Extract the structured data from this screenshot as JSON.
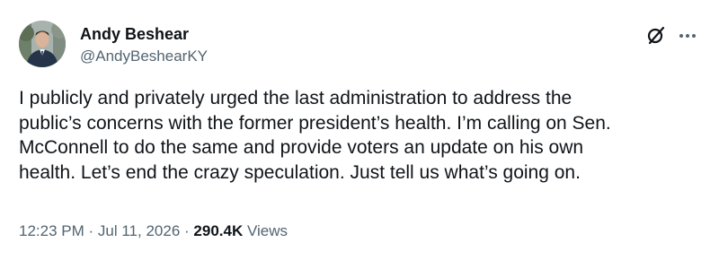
{
  "author": {
    "display_name": "Andy Beshear",
    "handle": "@AndyBeshearKY",
    "avatar_icon": "profile-photo"
  },
  "header_actions": {
    "grok_icon": "grok-icon",
    "more_icon": "more-options-icon"
  },
  "tweet": {
    "text": "I publicly and privately urged the last administration to address the\npublic’s concerns with the former president’s health. I’m calling on Sen.\nMcConnell to do the same and provide voters an update on his own\nhealth. Let’s end the crazy speculation. Just tell us what’s going on."
  },
  "meta": {
    "time": "12:23 PM",
    "separator": "·",
    "date": "Jul 11, 2026",
    "views_count": "290.4K",
    "views_label": "Views"
  },
  "colors": {
    "text_primary": "#0f1419",
    "text_secondary": "#536471"
  }
}
